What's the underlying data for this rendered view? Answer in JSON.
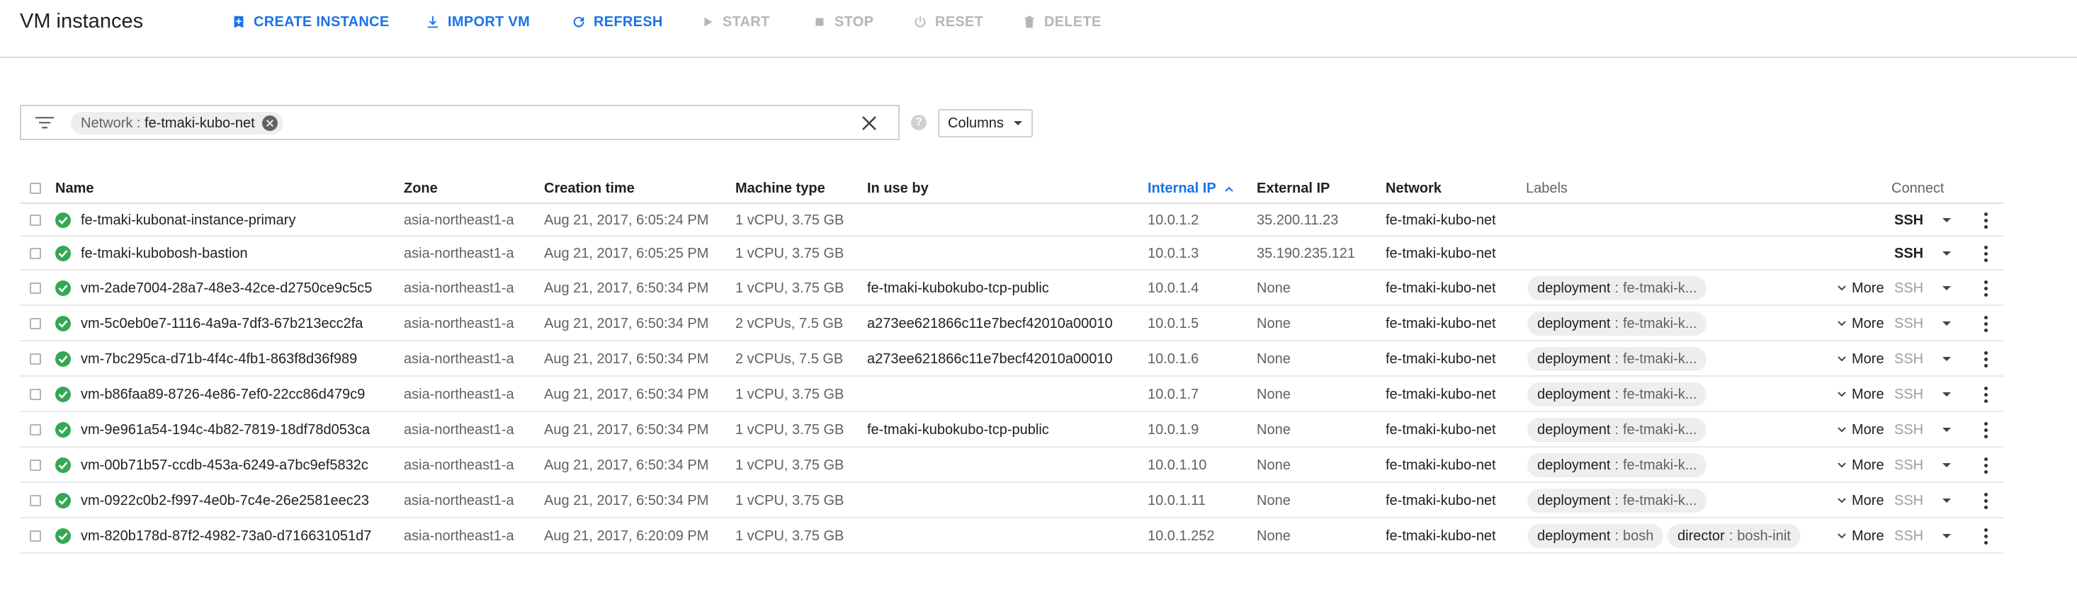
{
  "header": {
    "title": "VM instances",
    "actions": [
      {
        "label": "CREATE INSTANCE",
        "icon": "create-instance-icon",
        "enabled": true
      },
      {
        "label": "IMPORT VM",
        "icon": "import-icon",
        "enabled": true
      },
      {
        "label": "REFRESH",
        "icon": "refresh-icon",
        "enabled": true
      },
      {
        "label": "START",
        "icon": "play-icon",
        "enabled": false
      },
      {
        "label": "STOP",
        "icon": "stop-icon",
        "enabled": false
      },
      {
        "label": "RESET",
        "icon": "power-icon",
        "enabled": false
      },
      {
        "label": "DELETE",
        "icon": "trash-icon",
        "enabled": false
      }
    ]
  },
  "filter": {
    "chip_key": "Network",
    "chip_sep": " : ",
    "chip_value": "fe-tmaki-kubo-net"
  },
  "columns_button": "Columns",
  "table": {
    "headers": {
      "name": "Name",
      "zone": "Zone",
      "creation_time": "Creation time",
      "machine_type": "Machine type",
      "in_use_by": "In use by",
      "internal_ip": "Internal IP",
      "external_ip": "External IP",
      "network": "Network",
      "labels": "Labels",
      "connect": "Connect"
    },
    "sort": {
      "column": "Internal IP",
      "direction": "ascending"
    },
    "more_label": "More",
    "rows": [
      {
        "name": "fe-tmaki-kubonat-instance-primary",
        "zone": "asia-northeast1-a",
        "created": "Aug 21, 2017, 6:05:24 PM",
        "machine": "1 vCPU, 3.75 GB",
        "in_use_by": "",
        "internal_ip": "10.0.1.2",
        "external_ip": "35.200.11.23",
        "network": "fe-tmaki-kubo-net",
        "labels": [],
        "ssh": "SSH",
        "ssh_enabled": true
      },
      {
        "name": "fe-tmaki-kubobosh-bastion",
        "zone": "asia-northeast1-a",
        "created": "Aug 21, 2017, 6:05:25 PM",
        "machine": "1 vCPU, 3.75 GB",
        "in_use_by": "",
        "internal_ip": "10.0.1.3",
        "external_ip": "35.190.235.121",
        "network": "fe-tmaki-kubo-net",
        "labels": [],
        "ssh": "SSH",
        "ssh_enabled": true
      },
      {
        "name": "vm-2ade7004-28a7-48e3-42ce-d2750ce9c5c5",
        "zone": "asia-northeast1-a",
        "created": "Aug 21, 2017, 6:50:34 PM",
        "machine": "1 vCPU, 3.75 GB",
        "in_use_by": "fe-tmaki-kubokubo-tcp-public",
        "internal_ip": "10.0.1.4",
        "external_ip": "None",
        "network": "fe-tmaki-kubo-net",
        "labels": [
          {
            "key": "deployment",
            "value": "fe-tmaki-k..."
          }
        ],
        "ssh": "SSH",
        "ssh_enabled": false
      },
      {
        "name": "vm-5c0eb0e7-1116-4a9a-7df3-67b213ecc2fa",
        "zone": "asia-northeast1-a",
        "created": "Aug 21, 2017, 6:50:34 PM",
        "machine": "2 vCPUs, 7.5 GB",
        "in_use_by": "a273ee621866c11e7becf42010a00010",
        "internal_ip": "10.0.1.5",
        "external_ip": "None",
        "network": "fe-tmaki-kubo-net",
        "labels": [
          {
            "key": "deployment",
            "value": "fe-tmaki-k..."
          }
        ],
        "ssh": "SSH",
        "ssh_enabled": false
      },
      {
        "name": "vm-7bc295ca-d71b-4f4c-4fb1-863f8d36f989",
        "zone": "asia-northeast1-a",
        "created": "Aug 21, 2017, 6:50:34 PM",
        "machine": "2 vCPUs, 7.5 GB",
        "in_use_by": "a273ee621866c11e7becf42010a00010",
        "internal_ip": "10.0.1.6",
        "external_ip": "None",
        "network": "fe-tmaki-kubo-net",
        "labels": [
          {
            "key": "deployment",
            "value": "fe-tmaki-k..."
          }
        ],
        "ssh": "SSH",
        "ssh_enabled": false
      },
      {
        "name": "vm-b86faa89-8726-4e86-7ef0-22cc86d479c9",
        "zone": "asia-northeast1-a",
        "created": "Aug 21, 2017, 6:50:34 PM",
        "machine": "1 vCPU, 3.75 GB",
        "in_use_by": "",
        "internal_ip": "10.0.1.7",
        "external_ip": "None",
        "network": "fe-tmaki-kubo-net",
        "labels": [
          {
            "key": "deployment",
            "value": "fe-tmaki-k..."
          }
        ],
        "ssh": "SSH",
        "ssh_enabled": false
      },
      {
        "name": "vm-9e961a54-194c-4b82-7819-18df78d053ca",
        "zone": "asia-northeast1-a",
        "created": "Aug 21, 2017, 6:50:34 PM",
        "machine": "1 vCPU, 3.75 GB",
        "in_use_by": "fe-tmaki-kubokubo-tcp-public",
        "internal_ip": "10.0.1.9",
        "external_ip": "None",
        "network": "fe-tmaki-kubo-net",
        "labels": [
          {
            "key": "deployment",
            "value": "fe-tmaki-k..."
          }
        ],
        "ssh": "SSH",
        "ssh_enabled": false
      },
      {
        "name": "vm-00b71b57-ccdb-453a-6249-a7bc9ef5832c",
        "zone": "asia-northeast1-a",
        "created": "Aug 21, 2017, 6:50:34 PM",
        "machine": "1 vCPU, 3.75 GB",
        "in_use_by": "",
        "internal_ip": "10.0.1.10",
        "external_ip": "None",
        "network": "fe-tmaki-kubo-net",
        "labels": [
          {
            "key": "deployment",
            "value": "fe-tmaki-k..."
          }
        ],
        "ssh": "SSH",
        "ssh_enabled": false
      },
      {
        "name": "vm-0922c0b2-f997-4e0b-7c4e-26e2581eec23",
        "zone": "asia-northeast1-a",
        "created": "Aug 21, 2017, 6:50:34 PM",
        "machine": "1 vCPU, 3.75 GB",
        "in_use_by": "",
        "internal_ip": "10.0.1.11",
        "external_ip": "None",
        "network": "fe-tmaki-kubo-net",
        "labels": [
          {
            "key": "deployment",
            "value": "fe-tmaki-k..."
          }
        ],
        "ssh": "SSH",
        "ssh_enabled": false
      },
      {
        "name": "vm-820b178d-87f2-4982-73a0-d716631051d7",
        "zone": "asia-northeast1-a",
        "created": "Aug 21, 2017, 6:20:09 PM",
        "machine": "1 vCPU, 3.75 GB",
        "in_use_by": "",
        "internal_ip": "10.0.1.252",
        "external_ip": "None",
        "network": "fe-tmaki-kubo-net",
        "labels": [
          {
            "key": "deployment",
            "value": "bosh"
          },
          {
            "key": "director",
            "value": "bosh-init"
          }
        ],
        "ssh": "SSH",
        "ssh_enabled": false
      }
    ]
  },
  "colors": {
    "accent": "#1a73e8",
    "status_ok": "#34a853",
    "disabled": "#b6b6b6"
  }
}
